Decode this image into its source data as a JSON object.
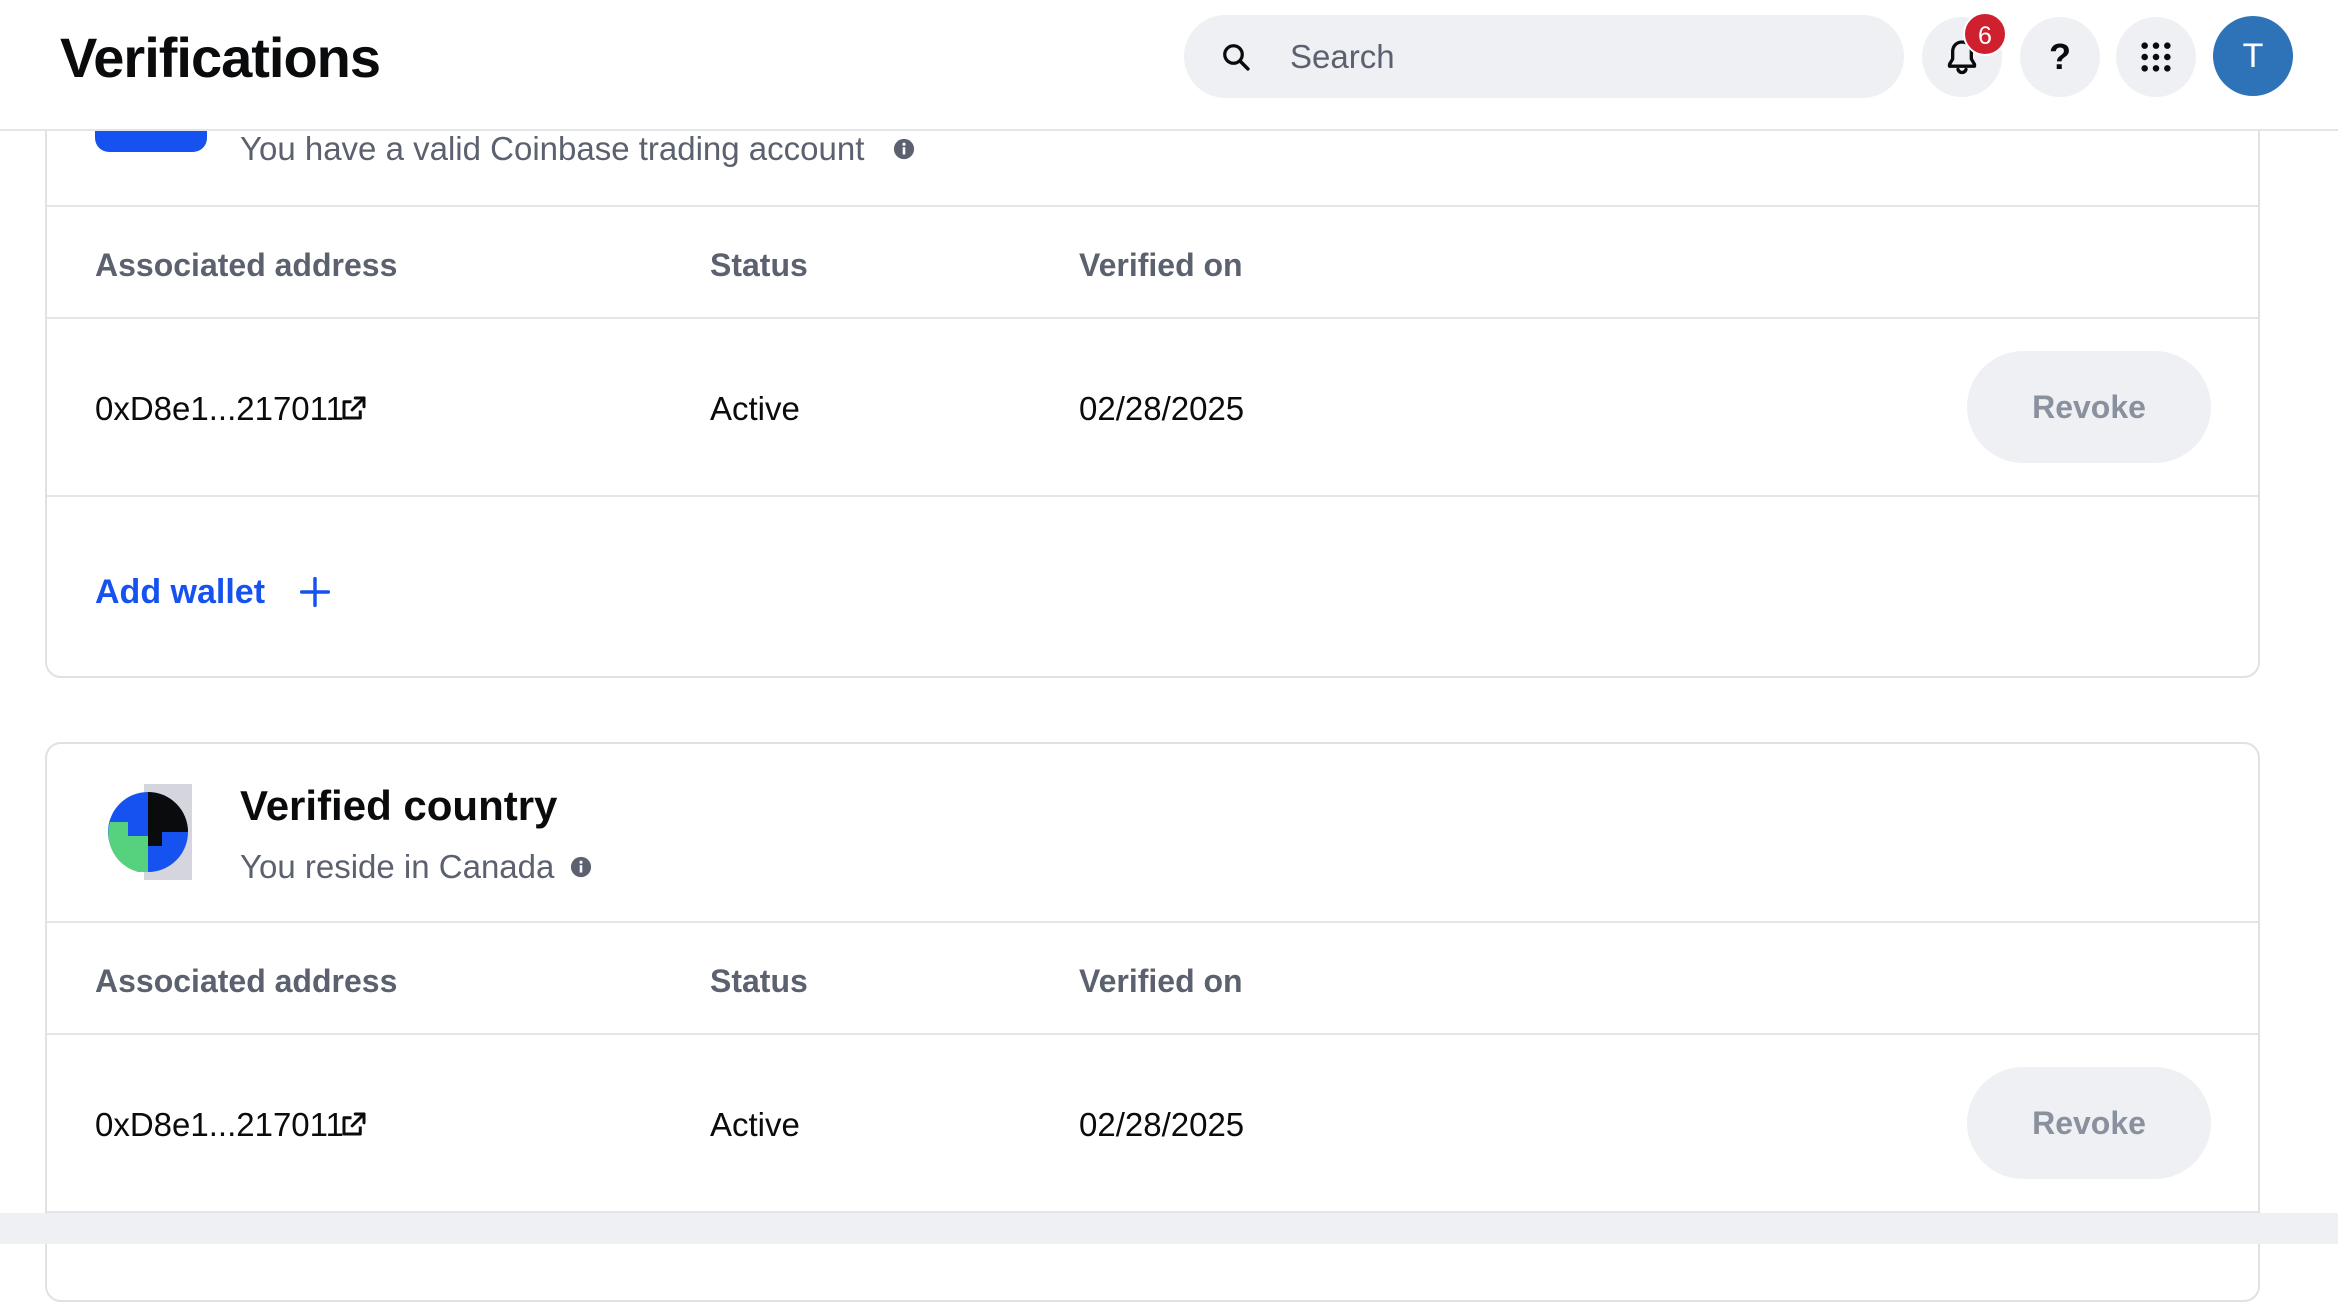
{
  "header": {
    "title": "Verifications",
    "search_placeholder": "Search",
    "notification_count": "6",
    "help_label": "?",
    "avatar_initial": "T"
  },
  "cards": [
    {
      "subtitle": "You have a valid Coinbase trading account",
      "columns": [
        "Associated address",
        "Status",
        "Verified on"
      ],
      "rows": [
        {
          "address": "0xD8e1...217011",
          "status": "Active",
          "verified_on": "02/28/2025",
          "action": "Revoke"
        }
      ],
      "add_wallet_label": "Add wallet"
    },
    {
      "title": "Verified country",
      "subtitle": "You reside in Canada",
      "columns": [
        "Associated address",
        "Status",
        "Verified on"
      ],
      "rows": [
        {
          "address": "0xD8e1...217011",
          "status": "Active",
          "verified_on": "02/28/2025",
          "action": "Revoke"
        }
      ]
    }
  ],
  "colors": {
    "brand_blue": "#1652f0",
    "badge_red": "#cf202f",
    "avatar_blue": "#2e73b8",
    "muted_text": "#5b616e"
  }
}
